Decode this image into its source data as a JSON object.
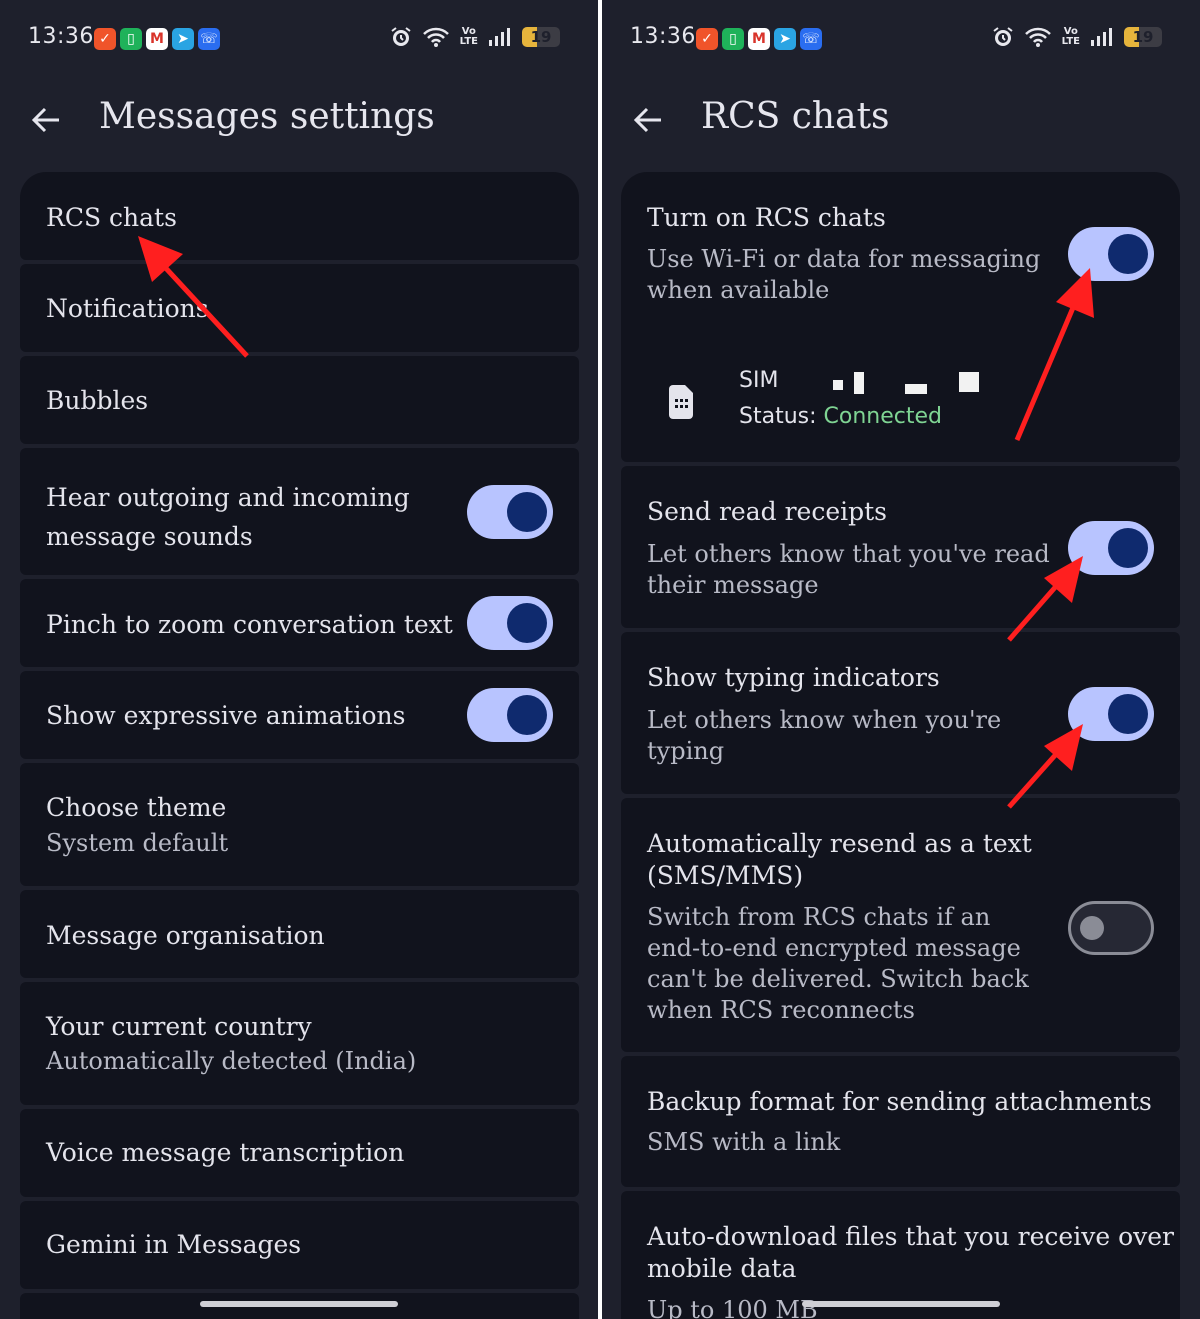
{
  "status_bar": {
    "time": "13:36",
    "battery_level": "19",
    "battery_fraction": 0.19,
    "volte_label_top": "Vo",
    "volte_label_bottom": "LTE",
    "icons": [
      "check-app-icon",
      "green-app-icon",
      "gmail-icon",
      "telegram-icon",
      "phone-app-icon",
      "alarm-icon",
      "wifi-icon",
      "volte-icon",
      "signal-icon",
      "battery-icon"
    ]
  },
  "left_screen": {
    "title": "Messages settings",
    "items": [
      {
        "title": "RCS chats"
      },
      {
        "title": "Notifications"
      },
      {
        "title": "Bubbles"
      },
      {
        "title": "Hear outgoing and incoming",
        "title_line2": "message sounds",
        "toggle": true
      },
      {
        "title": "Pinch to zoom conversation text",
        "toggle": true
      },
      {
        "title": "Show expressive animations",
        "toggle": true
      },
      {
        "title": "Choose theme",
        "subtitle": "System default"
      },
      {
        "title": "Message organisation"
      },
      {
        "title": "Your current country",
        "subtitle": "Automatically detected (India)"
      },
      {
        "title": "Voice message transcription"
      },
      {
        "title": "Gemini in Messages"
      }
    ]
  },
  "right_screen": {
    "title": "RCS chats",
    "rcs": {
      "title": "Turn on RCS chats",
      "subtitle_line1": "Use Wi-Fi or data for messaging",
      "subtitle_line2": "when available",
      "toggle": true,
      "sim_name": "SIM",
      "sim_status_label": "Status: ",
      "sim_status_value": "Connected"
    },
    "read_receipts": {
      "title": "Send read receipts",
      "subtitle_line1": "Let others know that you've read",
      "subtitle_line2": "their message",
      "toggle": true
    },
    "typing": {
      "title": "Show typing indicators",
      "subtitle_line1": "Let others know when you're",
      "subtitle_line2": "typing",
      "toggle": true
    },
    "resend": {
      "title_line1": "Automatically resend as a text",
      "title_line2": "(SMS/MMS)",
      "subtitle_line1": "Switch from RCS chats if an",
      "subtitle_line2": "end-to-end encrypted message",
      "subtitle_line3": "can't be delivered. Switch back",
      "subtitle_line4": "when RCS reconnects",
      "toggle": false
    },
    "backup": {
      "title": "Backup format for sending attachments",
      "subtitle": "SMS with a link"
    },
    "autodownload": {
      "title_line1": "Auto-download files that you receive over",
      "title_line2": "mobile data",
      "subtitle": "Up to 100 MB"
    }
  },
  "colors": {
    "background": "#1e202c",
    "card": "#11131d",
    "toggle_on_track": "#b8c4ff",
    "toggle_on_knob": "#0f2a6e",
    "connected": "#7fd493",
    "annotation_arrow": "#ff1f1f"
  }
}
